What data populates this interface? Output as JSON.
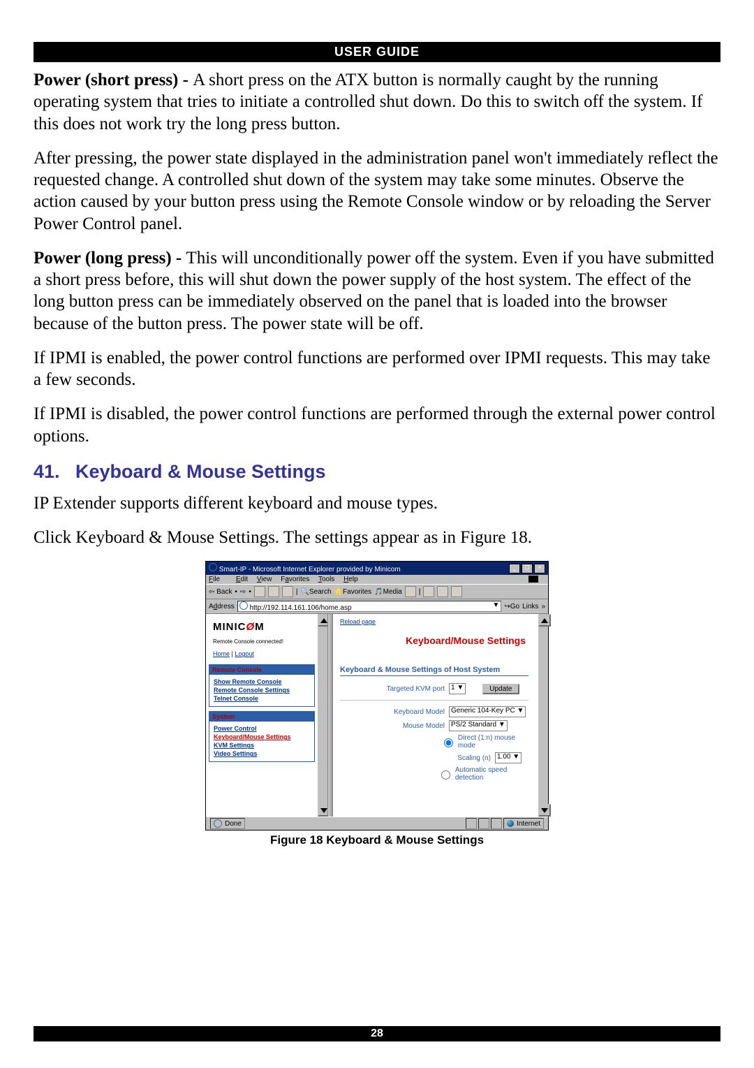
{
  "header": {
    "label": "USER GUIDE"
  },
  "p1": {
    "lead": "Power (short press) - ",
    "rest": "A short press on the ATX button is normally caught by the running operating system that tries to initiate a controlled shut down. Do this to switch off the system. If this does not work try the long press button."
  },
  "p2": "After pressing, the power state displayed in the administration panel won't immediately reflect the requested change. A controlled shut down of the system may take some minutes. Observe the action caused by your button press using the Remote Console window or by reloading the Server Power Control panel.",
  "p3": {
    "lead": "Power (long press) - ",
    "rest": "This will unconditionally power off the system. Even if you have submitted a short press before, this will shut down the power supply of the host system. The effect of the long button press can be immediately observed on the panel that is loaded into the browser because of the button press. The power state will be off."
  },
  "p4": "If IPMI is enabled, the power control functions are performed over IPMI requests. This may take a few seconds.",
  "p5": "If IPMI is disabled, the power control functions are performed through the external power control options.",
  "section": {
    "num": "41.",
    "title": "Keyboard & Mouse Settings"
  },
  "p6": "IP Extender supports different keyboard and mouse types.",
  "p7": "Click Keyboard & Mouse Settings. The settings appear as in Figure 18.",
  "figure": {
    "caption": "Figure 18 Keyboard & Mouse Settings",
    "titlebar": "Smart-IP - Microsoft Internet Explorer provided by Minicom",
    "menus": {
      "file": "File",
      "edit": "Edit",
      "view": "View",
      "favorites": "Favorites",
      "tools": "Tools",
      "help": "Help"
    },
    "toolbar": {
      "back": "Back",
      "search": "Search",
      "favorites": "Favorites",
      "media": "Media"
    },
    "addrLabel": "Address",
    "addrValue": "http://192.114.161.106/home.asp",
    "go": "Go",
    "links": "Links",
    "logo1": "MINIC",
    "logo2": "M",
    "connected": "Remote Console connected!",
    "home": "Home",
    "logout": "Logout",
    "sidebar": {
      "head1": "Remote Console",
      "link1": "Show Remote Console",
      "link2": "Remote Console Settings",
      "link3": "Telnet Console",
      "head2": "System",
      "link4": "Power Control",
      "link5": "Keyboard/Mouse Settings",
      "link6": "KVM Settings",
      "link7": "Video Settings"
    },
    "main": {
      "reload": "Reload page",
      "title": "Keyboard/Mouse Settings",
      "panelTitle": "Keyboard & Mouse Settings of Host System",
      "kvmLabel": "Targeted KVM port",
      "kvmValue": "1",
      "update": "Update",
      "kbModelLabel": "Keyboard Model",
      "kbModelValue": "Generic 104-Key PC",
      "mouseModelLabel": "Mouse Model",
      "mouseModelValue": "PS/2 Standard",
      "radio1": "Direct (1:n) mouse mode",
      "scalingLabel": "Scaling (n)",
      "scalingValue": "1.00",
      "radio2": "Automatic speed detection"
    },
    "status": {
      "done": "Done",
      "zone": "Internet"
    }
  },
  "footer": {
    "pageNum": "28"
  }
}
